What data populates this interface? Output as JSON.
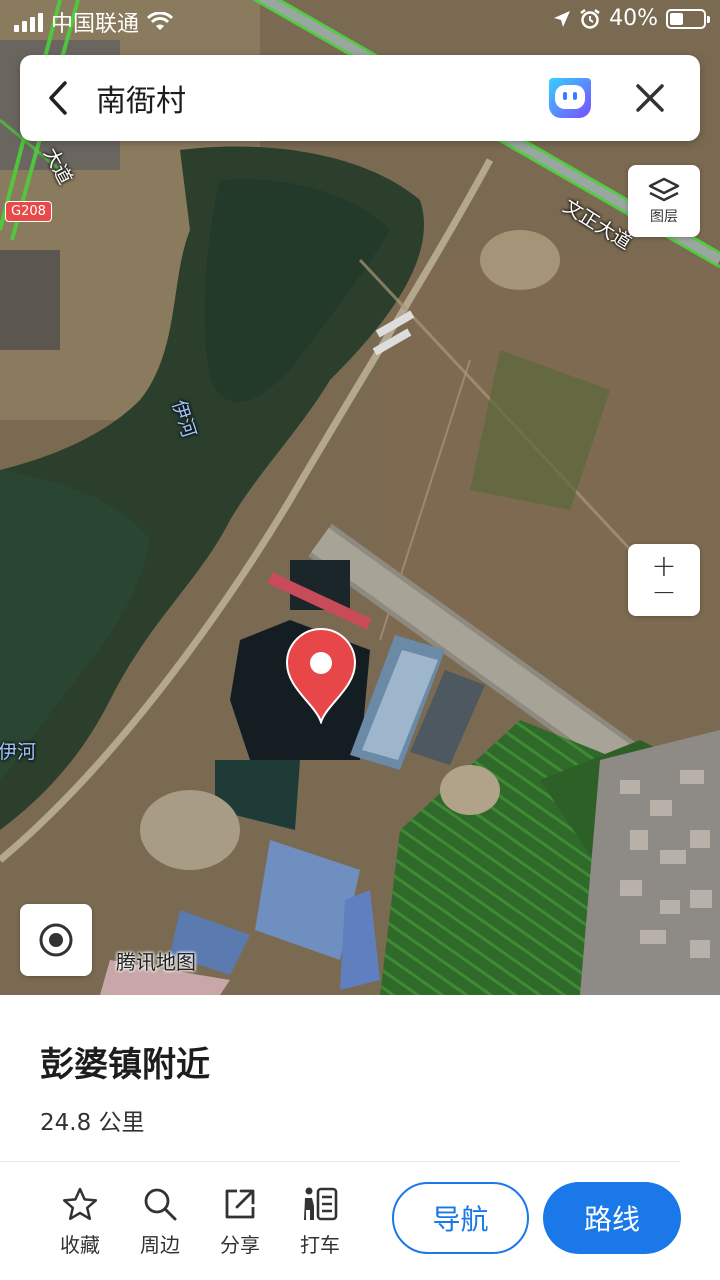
{
  "status_bar": {
    "carrier": "中国联通",
    "battery": "40%",
    "battery_level": 0.4
  },
  "search": {
    "query": "南衙村"
  },
  "map": {
    "layer_label": "图层",
    "zoom_in": "+",
    "zoom_out": "−",
    "labels": {
      "road_wenzheng": "文正大道",
      "road_partial": "大道",
      "route_badge": "G208",
      "river_1": "伊河",
      "river_2": "伊河"
    },
    "watermark": "腾讯地图"
  },
  "place": {
    "title": "彭婆镇附近",
    "distance": "24.8 公里"
  },
  "actions": [
    {
      "label": "收藏",
      "icon": "star-icon"
    },
    {
      "label": "周边",
      "icon": "search-icon"
    },
    {
      "label": "分享",
      "icon": "share-icon"
    },
    {
      "label": "打车",
      "icon": "taxi-icon"
    }
  ],
  "buttons": {
    "navigate": "导航",
    "route": "路线"
  },
  "colors": {
    "accent": "#1a78e8",
    "pin": "#e8474a"
  }
}
